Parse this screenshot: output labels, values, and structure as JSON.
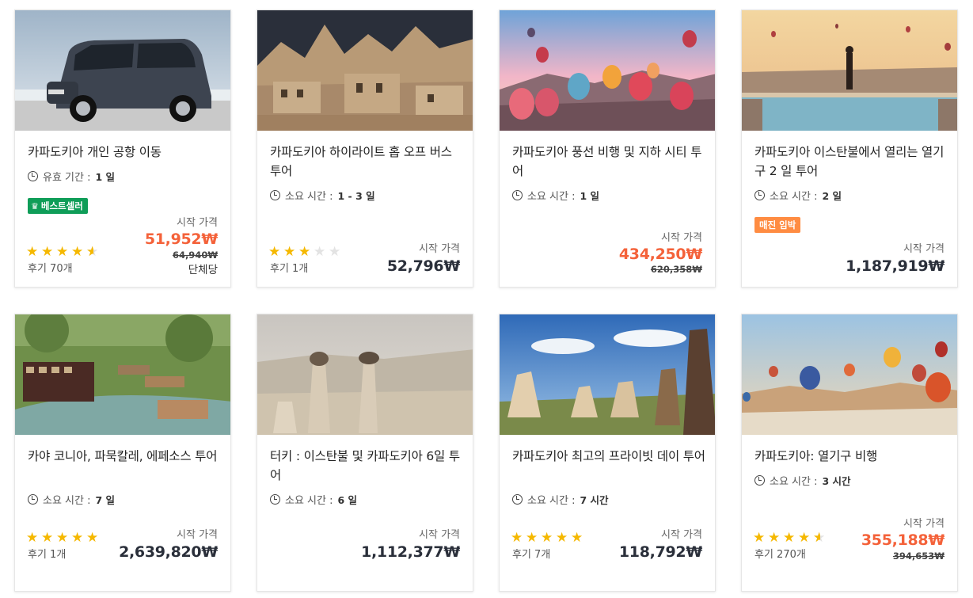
{
  "cards": [
    {
      "title": "카파도키아 개인 공항 이동",
      "duration_label": "유효 기간 :",
      "duration_value": "1 일",
      "badge": "베스트셀러",
      "rating": 4.5,
      "reviews": "후기 70개",
      "price_label": "시작 가격",
      "price": "51,952₩",
      "original_price": "64,940₩",
      "unit": "단체당",
      "image": "van-photo"
    },
    {
      "title": "카파도키아 하이라이트 홉 오프 버스 투어",
      "duration_label": "소요 시간 :",
      "duration_value": "1 - 3 일",
      "rating": 3,
      "reviews": "후기 1개",
      "price_label": "시작 가격",
      "price": "52,796₩",
      "image": "rock-houses-photo"
    },
    {
      "title": "카파도키아 풍선 비행 및 지하 시티 투어",
      "duration_label": "소요 시간 :",
      "duration_value": "1 일",
      "price_label": "시작 가격",
      "price": "434,250₩",
      "original_price": "620,358₩",
      "image": "balloons-sunset-photo"
    },
    {
      "title": "카파도키아 이스탄불에서 열리는 열기구 2 일 투어",
      "duration_label": "소요 시간 :",
      "duration_value": "2 일",
      "badge": "매진 임박",
      "price_label": "시작 가격",
      "price": "1,187,919₩",
      "image": "woman-pool-balloons-photo"
    },
    {
      "title": "카야 코니아, 파묵칼레, 에페소스 투어",
      "duration_label": "소요 시간 :",
      "duration_value": "7 일",
      "rating": 5,
      "reviews": "후기 1개",
      "price_label": "시작 가격",
      "price": "2,639,820₩",
      "image": "river-restaurant-photo"
    },
    {
      "title": "터키 : 이스탄불 및 카파도키아 6일 투어",
      "duration_label": "소요 시간 :",
      "duration_value": "6 일",
      "price_label": "시작 가격",
      "price": "1,112,377₩",
      "image": "fairy-chimneys-photo"
    },
    {
      "title": "카파도키아 최고의 프라이빗 데이 투어",
      "duration_label": "소요 시간 :",
      "duration_value": "7 시간",
      "rating": 5,
      "reviews": "후기 7개",
      "price_label": "시작 가격",
      "price": "118,792₩",
      "image": "rock-formations-sky-photo"
    },
    {
      "title": "카파도키아: 열기구 비행",
      "duration_label": "소요 시간 :",
      "duration_value": "3 시간",
      "rating": 4.5,
      "reviews": "후기 270개",
      "price_label": "시작 가격",
      "price": "355,188₩",
      "original_price": "394,653₩",
      "image": "balloons-valley-photo"
    }
  ],
  "colors": {
    "sale_price": "#f4623a",
    "regular_price": "#2a2f3a",
    "star": "#f5b800",
    "bestseller_badge": "#0f9d58",
    "selling_fast_badge": "#ff8c42"
  }
}
